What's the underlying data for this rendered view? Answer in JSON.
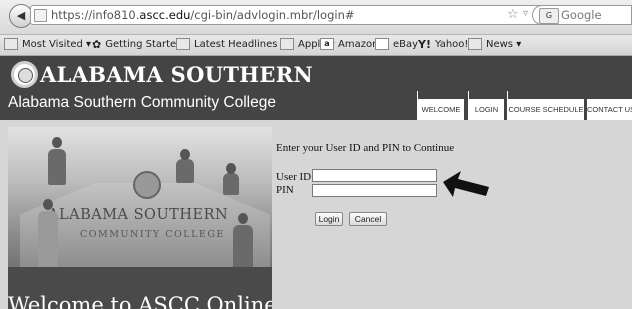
{
  "browser": {
    "url_prefix": "https://info810.",
    "url_domain": "ascc.edu",
    "url_path": "/cgi-bin/advlogin.mbr/login#",
    "search_placeholder": "Google",
    "search_engine_icon": "G",
    "star_icon": "☆",
    "dropdown_icon": "▿",
    "reload_icon": "C",
    "back_icon": "◀"
  },
  "bookmarks": [
    {
      "label": "Most Visited ▾",
      "icon": "bookmarks-icon"
    },
    {
      "label": "Getting Started",
      "icon": "firefox-icon"
    },
    {
      "label": "Latest Headlines ▾",
      "icon": "rss-icon"
    },
    {
      "label": "Apple ▾",
      "icon": "folder-icon"
    },
    {
      "label": "Amazon",
      "icon": "amazon-icon"
    },
    {
      "label": "eBay",
      "icon": "page-icon"
    },
    {
      "label": "Yahoo!",
      "icon": "yahoo-icon"
    },
    {
      "label": "News ▾",
      "icon": "folder-icon"
    }
  ],
  "header": {
    "logo_text": "ALABAMA SOUTHERN",
    "college_name": "Alabama Southern Community College"
  },
  "nav": {
    "welcome": "WELCOME",
    "login": "LOGIN",
    "schedule": "COURSE SCHEDULE",
    "contact": "CONTACT US"
  },
  "photo": {
    "sign_top": "ALABAMA SOUTHERN",
    "sign_bottom": "COMMUNITY COLLEGE",
    "banner": "Welcome to ASCC Online"
  },
  "login": {
    "prompt": "Enter your User ID and PIN to Continue",
    "userid_label": "User ID",
    "pin_label": "PIN",
    "userid_value": "",
    "pin_value": "",
    "login_button": "Login",
    "cancel_button": "Cancel"
  }
}
